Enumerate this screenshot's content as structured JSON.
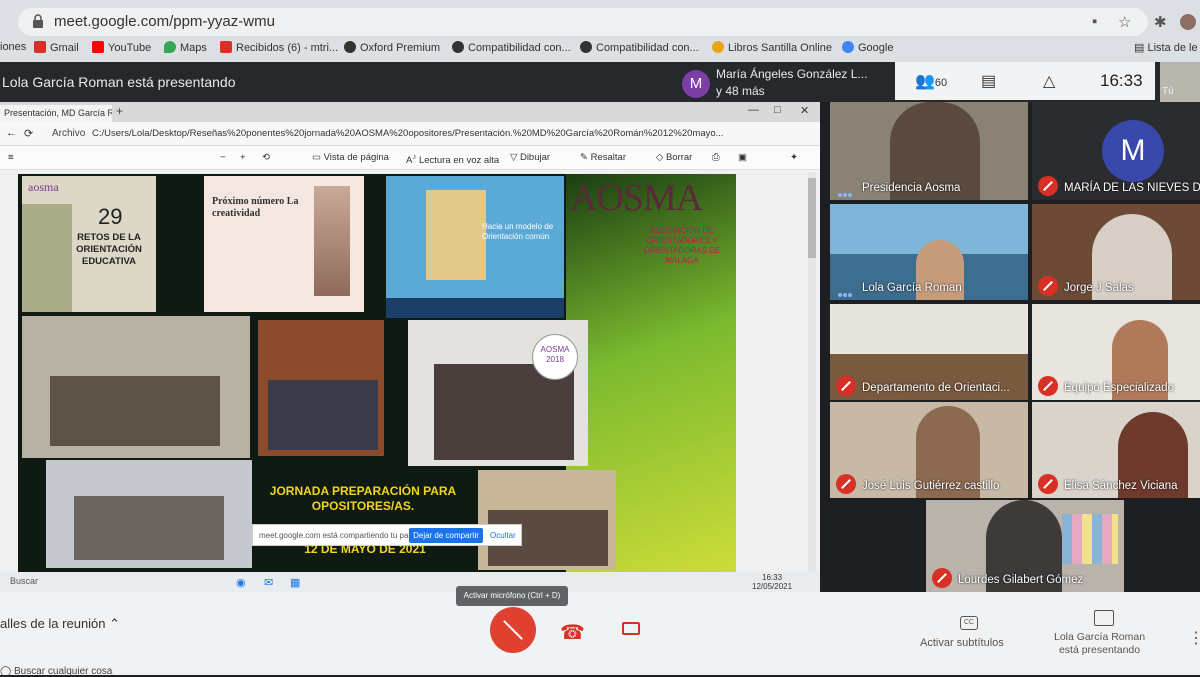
{
  "browser": {
    "url": "meet.google.com/ppm-yyaz-wmu",
    "bookmarks": [
      {
        "label": "iones",
        "color": "#ffffff"
      },
      {
        "label": "Gmail",
        "color": "#d93025"
      },
      {
        "label": "YouTube",
        "color": "#ff0000"
      },
      {
        "label": "Maps",
        "color": "#34a853"
      },
      {
        "label": "Recibidos (6) - mtri...",
        "color": "#d93025"
      },
      {
        "label": "Oxford Premium",
        "color": "#333333"
      },
      {
        "label": "Compatibilidad con...",
        "color": "#333333"
      },
      {
        "label": "Compatibilidad con...",
        "color": "#333333"
      },
      {
        "label": "Libros Santilla Online",
        "color": "#e8a317"
      },
      {
        "label": "Google",
        "color": "#4285f4"
      }
    ],
    "reading_list": "Lista de le"
  },
  "meet": {
    "presenting_title": "Lola García Roman está presentando",
    "host_initial": "M",
    "host_name": "María Ángeles González L...",
    "host_more": "y 48 más",
    "people_count": "60",
    "clock": "16:33",
    "self_label": "Tú"
  },
  "shared": {
    "tab_title": "Presentación, MD García Román",
    "url_label": "Archivo",
    "url": "C:/Users/Lola/Desktop/Reseñas%20ponentes%20jornada%20AOSMA%20opositores/Presentación.%20MD%20García%20Román%2012%20mayo...",
    "toolbar": {
      "page_view": "Vista de página",
      "read_aloud": "Lectura en voz alta",
      "draw": "Dibujar",
      "highlight": "Resaltar",
      "erase": "Borrar"
    },
    "taskbar_search": "Buscar",
    "taskbar_time": "16:33",
    "taskbar_date": "12/05/2021"
  },
  "slide": {
    "book_number": "29",
    "book_title": "RETOS DE LA ORIENTACIÓN EDUCATIVA",
    "book_logo": "aosma",
    "next_issue_title": "Próximo número La creatividad",
    "poster_title": "Hacia un modelo de Orientación común",
    "brand": "AOSMA",
    "brand_sub": "ASOCIACIÓN DE ORIENTADORES Y ORIENTADORAS DE MÁLAGA",
    "photo_badge": "AOSMA 2018",
    "headline": "JORNADA PREPARACIÓN PARA OPOSITORES/AS.",
    "date": "12 DE MAYO DE 2021",
    "colors": {
      "green": "#7cba2f",
      "magenta": "#c2185b",
      "yellow": "#f2d51e"
    }
  },
  "share_banner": {
    "text": "meet.google.com está compartiendo tu pantalla.",
    "stop": "Dejar de compartir",
    "hide": "Ocultar"
  },
  "tiles": [
    {
      "name": "Presidencia Aosma",
      "muted": false
    },
    {
      "name": "MARÍA DE LAS NIEVES D",
      "muted": true,
      "initial": "M"
    },
    {
      "name": "Lola García Roman",
      "muted": false
    },
    {
      "name": "Jorge J Salas",
      "muted": true
    },
    {
      "name": "Departamento de Orientaci...",
      "muted": true
    },
    {
      "name": "Equipo Especializado",
      "muted": true
    },
    {
      "name": "José Luis Gutiérrez castillo",
      "muted": true
    },
    {
      "name": "Elisa Sánchez Viciana",
      "muted": true
    },
    {
      "name": "Lourdes Gilabert Gómez",
      "muted": true
    }
  ],
  "bottom": {
    "details": "alles de la reunión",
    "mic_tooltip": "Activar micrófono (Ctrl + D)",
    "captions": "Activar subtítulos",
    "presenter_line1": "Lola García Roman",
    "presenter_line2": "está presentando",
    "windows_search": "Buscar cualquier cosa"
  }
}
